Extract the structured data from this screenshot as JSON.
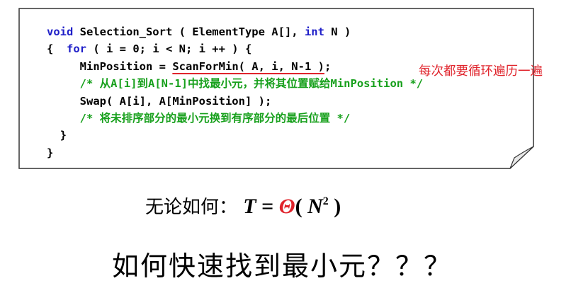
{
  "code": {
    "line1": {
      "kw": "void",
      "text": " Selection_Sort ( ElementType A[], ",
      "kw2": "int",
      "text2": " N )"
    },
    "line2": {
      "brace": "{  ",
      "kw": "for",
      "text": " ( i = 0; i < N; i ++ ) {"
    },
    "line3": {
      "indent": "     ",
      "pre": "MinPosition = ",
      "scan": "ScanForMin( A, i, N-1 )",
      "post": ";"
    },
    "line4": {
      "indent": "     ",
      "comment": "/* 从A[i]到A[N-1]中找最小元，并将其位置赋给MinPosition */"
    },
    "line5": {
      "indent": "     ",
      "text": "Swap( A[i], A[MinPosition] );"
    },
    "line6": {
      "indent": "     ",
      "comment": "/* 将未排序部分的最小元换到有序部分的最后位置 */"
    },
    "line7": {
      "text": "  }"
    },
    "line8": {
      "text": "}"
    },
    "note": "每次都要循环遍历一遍"
  },
  "formula": {
    "label": "无论如何：",
    "T": "T",
    "eq": " = ",
    "theta": "Θ",
    "open": "( ",
    "N": "N",
    "exp": "2",
    "close": " )"
  },
  "question": "如何快速找到最小元？？？",
  "colors": {
    "keyword": "#1f1fc8",
    "comment": "#17a01c",
    "accent": "#e0242c"
  }
}
